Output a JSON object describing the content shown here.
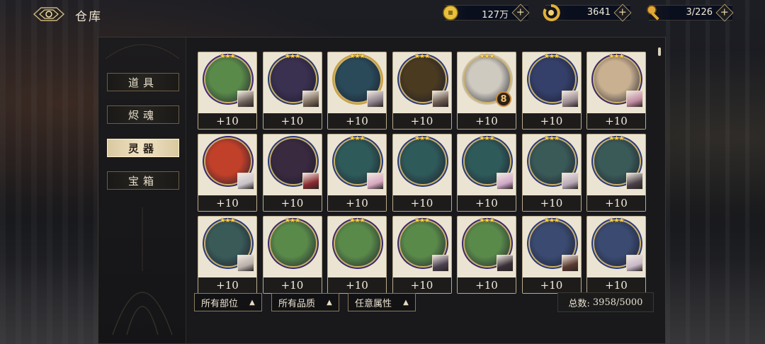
{
  "header": {
    "title": "仓库",
    "resources": [
      {
        "icon": "coin-icon",
        "value": "127万",
        "color": "#e8c040"
      },
      {
        "icon": "spirit-ring-icon",
        "value": "3641",
        "color": "#e2b03a"
      },
      {
        "icon": "key-icon",
        "value": "3/226",
        "color": "#e0a838"
      }
    ]
  },
  "sidebar": {
    "items": [
      {
        "label": "道具",
        "active": false
      },
      {
        "label": "烬魂",
        "active": false
      },
      {
        "label": "灵器",
        "active": true
      },
      {
        "label": "宝箱",
        "active": false
      }
    ]
  },
  "items": [
    {
      "level": "+10",
      "icon": "lotus-icon",
      "stars": "★★★",
      "frame": "#3d2a7a",
      "color": "#5a8a4a",
      "badge": "avatar",
      "avatar": "#6b5f58"
    },
    {
      "level": "+10",
      "icon": "bracelet-icon",
      "stars": "★★★",
      "frame": "#2a3a6a",
      "color": "#3a3050",
      "badge": "avatar",
      "avatar": "#7a6a5a"
    },
    {
      "level": "+10",
      "icon": "dragon-orb-icon",
      "stars": "★★★",
      "frame": "#c9a040",
      "color": "#2a4a5a",
      "badge": "avatar",
      "avatar": "#8a8088"
    },
    {
      "level": "+10",
      "icon": "mech-icon",
      "stars": "★★★",
      "frame": "#2a3a7a",
      "color": "#4a3a20",
      "badge": "avatar",
      "avatar": "#6a5a50"
    },
    {
      "level": "+10",
      "icon": "white-beast-icon",
      "stars": "★★★",
      "frame": "#c9c0a8",
      "color": "#cfcac0",
      "badge": "level",
      "badge_text": "8"
    },
    {
      "level": "+10",
      "icon": "blue-beast-icon",
      "stars": "★★★",
      "frame": "#2a3a7a",
      "color": "#34406a",
      "badge": "avatar",
      "avatar": "#9a8a90"
    },
    {
      "level": "+10",
      "icon": "doll-icon",
      "stars": "★★★",
      "frame": "#3a2a6a",
      "color": "#c9b090",
      "badge": "avatar",
      "avatar": "#c08aa0"
    },
    {
      "level": "+10",
      "icon": "fire-swirl-icon",
      "stars": "",
      "frame": "#3a2a6a",
      "color": "#c0402a",
      "badge": "avatar",
      "avatar": "#c9c2c8"
    },
    {
      "level": "+10",
      "icon": "golden-blade-icon",
      "stars": "",
      "frame": "#2a3a7a",
      "color": "#3a2a40",
      "badge": "avatar",
      "avatar": "#8a2a30"
    },
    {
      "level": "+10",
      "icon": "green-vine-icon",
      "stars": "★★★",
      "frame": "#2a3a7a",
      "color": "#2f5a5a",
      "badge": "avatar",
      "avatar": "#d8a8c0"
    },
    {
      "level": "+10",
      "icon": "green-vine-icon",
      "stars": "★★★",
      "frame": "#2a3a7a",
      "color": "#2f5a5a",
      "badge": "none"
    },
    {
      "level": "+10",
      "icon": "green-vine-icon",
      "stars": "★★★",
      "frame": "#2a3a7a",
      "color": "#2f5a5a",
      "badge": "avatar",
      "avatar": "#d0a8c8"
    },
    {
      "level": "+10",
      "icon": "peacock-icon",
      "stars": "★★★",
      "frame": "#2a3a7a",
      "color": "#3a5a58",
      "badge": "avatar",
      "avatar": "#b8a8b8"
    },
    {
      "level": "+10",
      "icon": "peacock-icon",
      "stars": "★★★",
      "frame": "#2a3a7a",
      "color": "#3a5a58",
      "badge": "avatar",
      "avatar": "#4a4048"
    },
    {
      "level": "+10",
      "icon": "peacock-icon",
      "stars": "★★★",
      "frame": "#2a3a7a",
      "color": "#3a5a58",
      "badge": "avatar",
      "avatar": "#b8b0a8"
    },
    {
      "level": "+10",
      "icon": "lotus-icon",
      "stars": "★★★",
      "frame": "#3a2a6a",
      "color": "#5a8a4a",
      "badge": "none"
    },
    {
      "level": "+10",
      "icon": "lotus-icon",
      "stars": "★★★",
      "frame": "#3a2a6a",
      "color": "#5a8a4a",
      "badge": "none"
    },
    {
      "level": "+10",
      "icon": "lotus-icon",
      "stars": "★★★",
      "frame": "#3a2a6a",
      "color": "#5a8a4a",
      "badge": "avatar",
      "avatar": "#4a4050"
    },
    {
      "level": "+10",
      "icon": "lotus-icon",
      "stars": "★★★",
      "frame": "#3a2a6a",
      "color": "#5a8a4a",
      "badge": "avatar",
      "avatar": "#3a3038"
    },
    {
      "level": "+10",
      "icon": "white-flower-icon",
      "stars": "★★★",
      "frame": "#2a3a7a",
      "color": "#3a4a70",
      "badge": "avatar",
      "avatar": "#5a3a30"
    },
    {
      "level": "+10",
      "icon": "white-flower-icon",
      "stars": "★★★",
      "frame": "#2a3a7a",
      "color": "#3a4a70",
      "badge": "avatar",
      "avatar": "#c8b8c8"
    }
  ],
  "filters": [
    {
      "label": "所有部位"
    },
    {
      "label": "所有品质"
    },
    {
      "label": "任意属性"
    }
  ],
  "total": {
    "label": "总数:",
    "value": "3958/5000"
  }
}
